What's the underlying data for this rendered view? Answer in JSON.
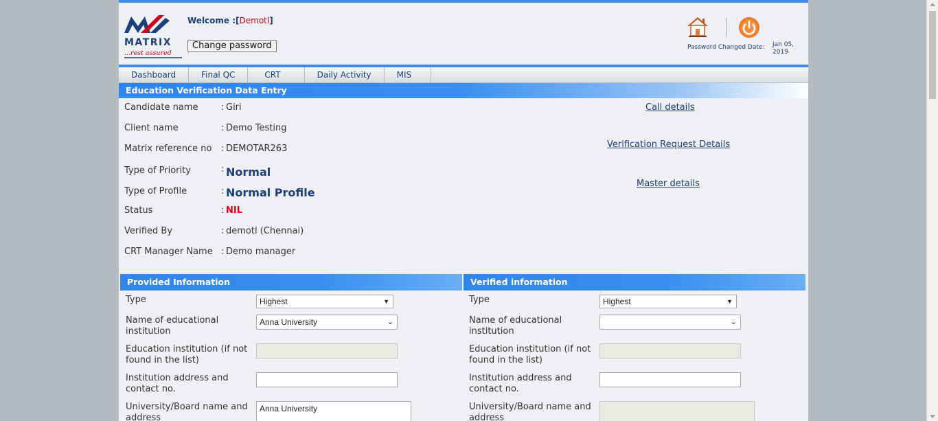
{
  "header": {
    "logo_text": "MATRIX",
    "logo_tagline": "...rest assured",
    "welcome_label": "Welcome :[",
    "username": "Demotl",
    "welcome_close": "]",
    "change_password": "Change password",
    "password_changed_label": "Password Changed Date:",
    "password_changed_date": "Jan 05, 2019",
    "home_icon": "home-icon",
    "power_icon": "power-icon"
  },
  "nav": {
    "items": [
      "Dashboard",
      "Final QC",
      "CRT",
      "Daily Activity",
      "MIS"
    ]
  },
  "section": {
    "title": "Education Verification Data Entry"
  },
  "details": {
    "candidate_name": {
      "label": "Candidate name",
      "value": "Giri"
    },
    "client_name": {
      "label": "Client name",
      "value": "Demo Testing"
    },
    "matrix_ref": {
      "label": "Matrix reference no",
      "value": "DEMOTAR263"
    },
    "priority": {
      "label": "Type of Priority",
      "value": "Normal"
    },
    "profile": {
      "label": "Type of Profile",
      "value": "Normal Profile"
    },
    "status": {
      "label": "Status",
      "value": "NIL"
    },
    "verified_by": {
      "label": "Verified By",
      "value": "demotl (Chennai)"
    },
    "crt_manager": {
      "label": "CRT Manager Name",
      "value": "Demo manager"
    },
    "colon": ":"
  },
  "links": {
    "call_details": "Call details",
    "verification_request": "Verification Request Details",
    "master_details": "Master details"
  },
  "provided": {
    "title": "Provided Information",
    "type_label": "Type",
    "type_value": "Highest",
    "institution_label": "Name of educational institution",
    "institution_value": "Anna University",
    "institution_other_label": "Education institution (if not found in the list)",
    "institution_other_value": "",
    "address_label": "Institution address and contact no.",
    "address_value": "",
    "university_label": "University/Board name and address",
    "university_value": "Anna University"
  },
  "verified": {
    "title": "Verified information",
    "type_label": "Type",
    "type_value": "Highest",
    "institution_label": "Name of educational institution",
    "institution_value": "",
    "institution_other_label": "Education institution (if not found in the list)",
    "institution_other_value": "",
    "address_label": "Institution address and contact no.",
    "address_value": "",
    "university_label": "University/Board name and address",
    "university_value": ""
  },
  "colors": {
    "accent": "#3d8ef0",
    "brand_blue": "#1d3f7a",
    "status_red": "#e0001a",
    "home_roof": "#c8541f",
    "power": "#f07a25"
  }
}
